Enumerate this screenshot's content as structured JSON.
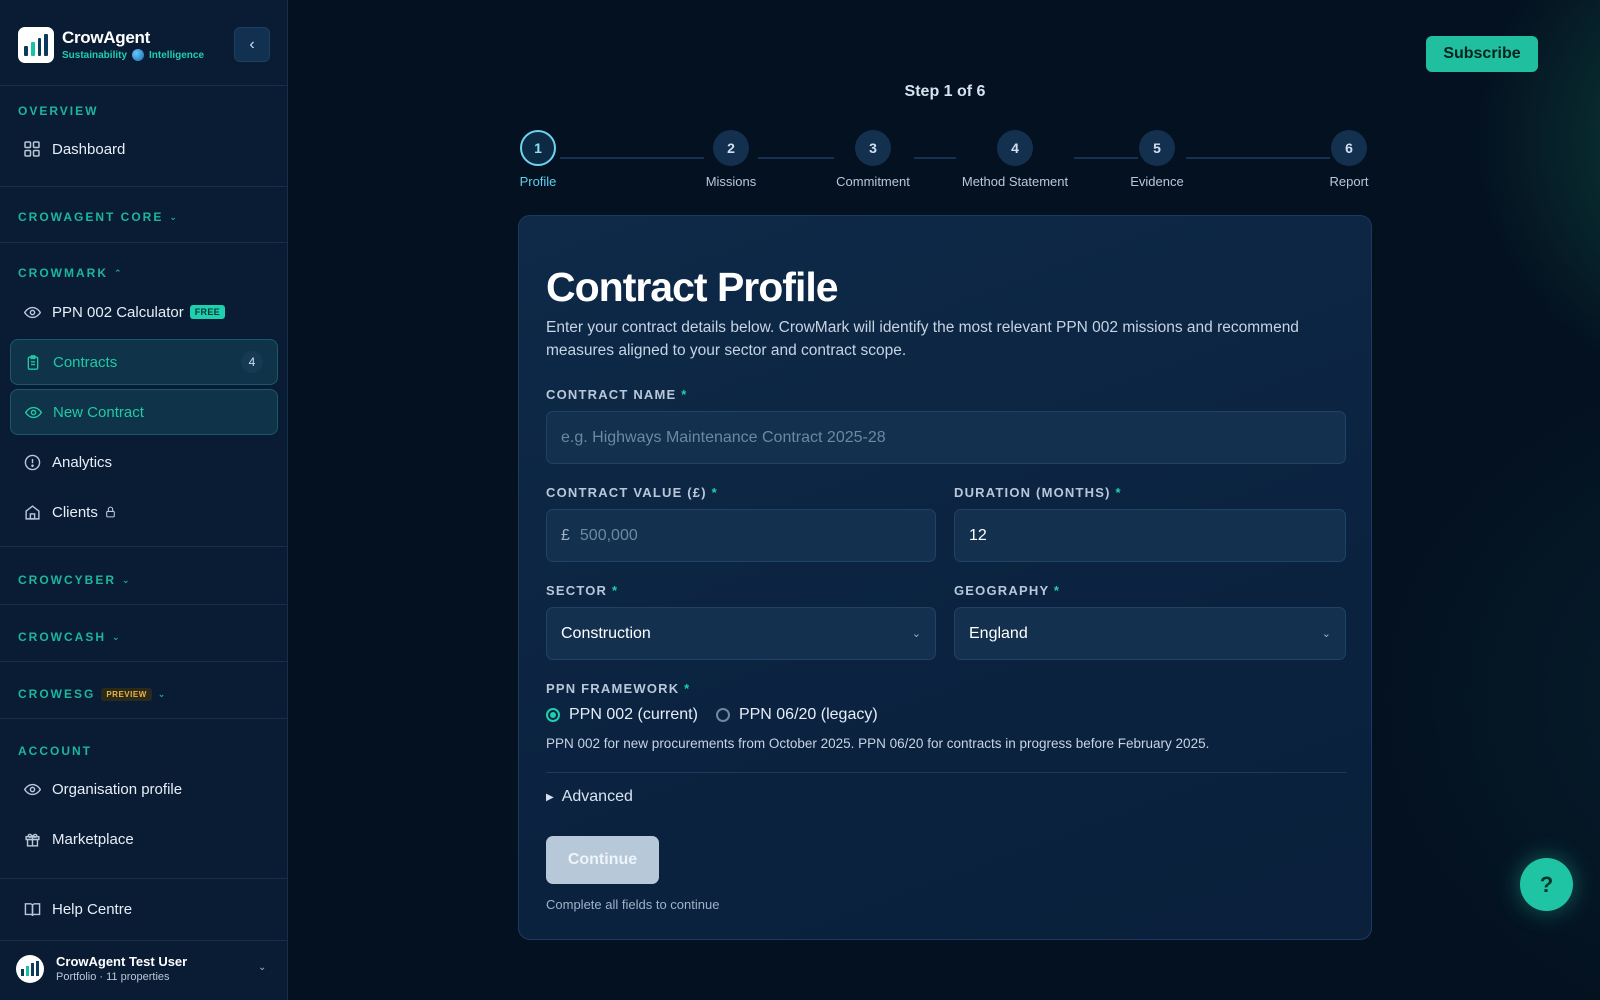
{
  "brand": {
    "name": "CrowAgent",
    "tagline_left": "Sustainability",
    "tagline_right": "Intelligence"
  },
  "sidebar": {
    "overview_label": "OVERVIEW",
    "dashboard": "Dashboard",
    "core_label": "CROWAGENT CORE",
    "crowmark_label": "CROWMARK",
    "ppn_calc": "PPN 002 Calculator",
    "free_badge": "FREE",
    "contracts": "Contracts",
    "contracts_count": "4",
    "new_contract": "New Contract",
    "analytics": "Analytics",
    "clients": "Clients",
    "crowcyber_label": "CROWCYBER",
    "crowcash_label": "CROWCASH",
    "crowesg_label": "CROWESG",
    "preview_badge": "PREVIEW",
    "account_label": "ACCOUNT",
    "org_profile": "Organisation profile",
    "marketplace": "Marketplace",
    "help_centre": "Help Centre"
  },
  "user": {
    "name": "CrowAgent Test User",
    "subtitle": "Portfolio · 11 properties"
  },
  "header": {
    "subscribe": "Subscribe",
    "step_indicator": "Step 1 of 6"
  },
  "steps": [
    {
      "num": "1",
      "label": "Profile"
    },
    {
      "num": "2",
      "label": "Missions"
    },
    {
      "num": "3",
      "label": "Commitment"
    },
    {
      "num": "4",
      "label": "Method Statement"
    },
    {
      "num": "5",
      "label": "Evidence"
    },
    {
      "num": "6",
      "label": "Report"
    }
  ],
  "form": {
    "title": "Contract Profile",
    "description": "Enter your contract details below. CrowMark will identify the most relevant PPN 002 missions and recommend measures aligned to your sector and contract scope.",
    "contract_name_label": "CONTRACT NAME",
    "contract_name_placeholder": "e.g. Highways Maintenance Contract 2025-28",
    "contract_value_label": "CONTRACT VALUE (£)",
    "currency_symbol": "£",
    "contract_value_placeholder": "500,000",
    "duration_label": "DURATION (MONTHS)",
    "duration_value": "12",
    "sector_label": "SECTOR",
    "sector_value": "Construction",
    "geography_label": "GEOGRAPHY",
    "geography_value": "England",
    "framework_label": "PPN FRAMEWORK",
    "framework_options": [
      "PPN 002 (current)",
      "PPN 06/20 (legacy)"
    ],
    "framework_selected": "PPN 002 (current)",
    "framework_help": "PPN 002 for new procurements from October 2025. PPN 06/20 for contracts in progress before February 2025.",
    "advanced": "Advanced",
    "continue": "Continue",
    "complete_note": "Complete all fields to continue",
    "required_mark": "*"
  },
  "help_fab": "?",
  "colors": {
    "accent": "#1fc4a4",
    "background": "#041120",
    "sidebar": "#0a1c33",
    "card": "#0e2a48"
  }
}
